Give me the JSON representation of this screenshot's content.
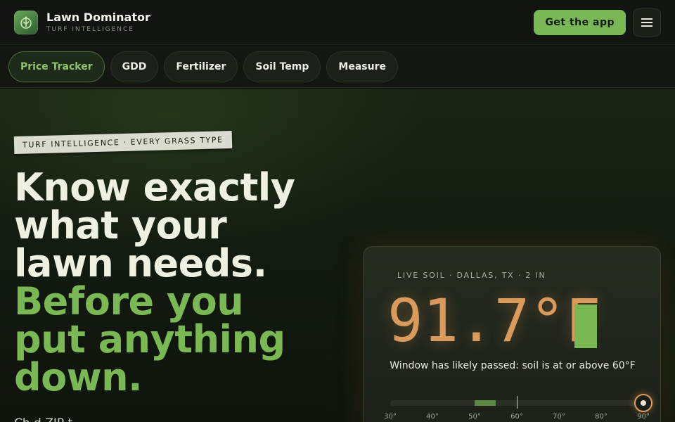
{
  "header": {
    "brand_name": "Lawn Dominator",
    "brand_tag": "TURF INTELLIGENCE",
    "cta_label": "Get the app",
    "menu_icon": "hamburger-menu-icon",
    "logo_icon": "lawn-logo-icon"
  },
  "nav": {
    "tabs": [
      {
        "label": "Price Tracker",
        "active": true
      },
      {
        "label": "GDD",
        "active": false
      },
      {
        "label": "Fertilizer",
        "active": false
      },
      {
        "label": "Soil Temp",
        "active": false
      },
      {
        "label": "Measure",
        "active": false
      }
    ]
  },
  "hero": {
    "eyebrow": "TURF INTELLIGENCE · EVERY GRASS TYPE",
    "headline_light": [
      "Know exactly",
      "what your",
      "lawn needs."
    ],
    "headline_green": [
      "Before you",
      "put anything",
      "down."
    ],
    "subline": "Ch                          d ZIP                   t"
  },
  "soil_card": {
    "label": "LIVE SOIL · DALLAS, TX · 2 IN",
    "temperature": "91.7°F",
    "temperature_value": 91.7,
    "message": "Window has likely passed: soil is at or above 60°F",
    "scale_min": 30,
    "scale_max": 90,
    "window_start": 50,
    "window_end": 55,
    "threshold": 60,
    "ticks": [
      "30°",
      "40°",
      "50°",
      "60°",
      "70°",
      "80°",
      "90°"
    ]
  },
  "colors": {
    "accent_green": "#7ab854",
    "temp_orange": "#d99a5b",
    "background": "#0f130d"
  }
}
